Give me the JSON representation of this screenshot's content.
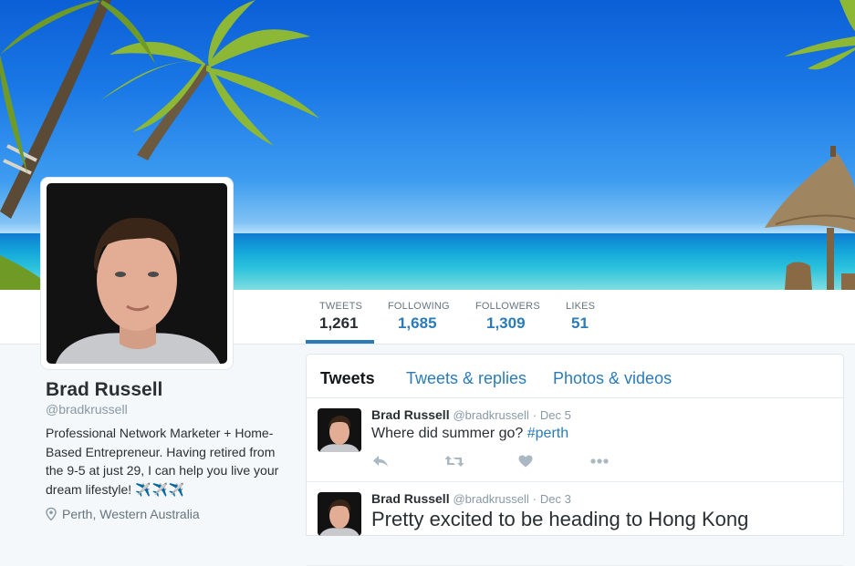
{
  "profile": {
    "name": "Brad Russell",
    "handle": "@bradkrussell",
    "bio": "Professional Network Marketer + Home-Based Entrepreneur. Having retired from the 9-5 at just 29, I can help you live your dream lifestyle!",
    "bio_emoji": "✈️✈️✈️",
    "location": "Perth, Western Australia"
  },
  "stats": [
    {
      "label": "TWEETS",
      "value": "1,261"
    },
    {
      "label": "FOLLOWING",
      "value": "1,685"
    },
    {
      "label": "FOLLOWERS",
      "value": "1,309"
    },
    {
      "label": "LIKES",
      "value": "51"
    }
  ],
  "tabs": [
    "Tweets",
    "Tweets & replies",
    "Photos & videos"
  ],
  "tweets": [
    {
      "name": "Brad Russell",
      "handle": "@bradkrussell",
      "date": "Dec 5",
      "text": "Where did summer go?",
      "hashtag": "#perth"
    },
    {
      "name": "Brad Russell",
      "handle": "@bradkrussell",
      "date": "Dec 3",
      "text": "Pretty excited to be heading to Hong Kong"
    }
  ],
  "icons": {
    "reply": "reply-icon",
    "retweet": "retweet-icon",
    "like": "heart-icon",
    "more": "more-icon",
    "location": "location-pin-icon"
  },
  "colors": {
    "link": "#2b7bb9",
    "background": "#f5f8fa",
    "text": "#292f33",
    "muted": "#8899a6"
  }
}
